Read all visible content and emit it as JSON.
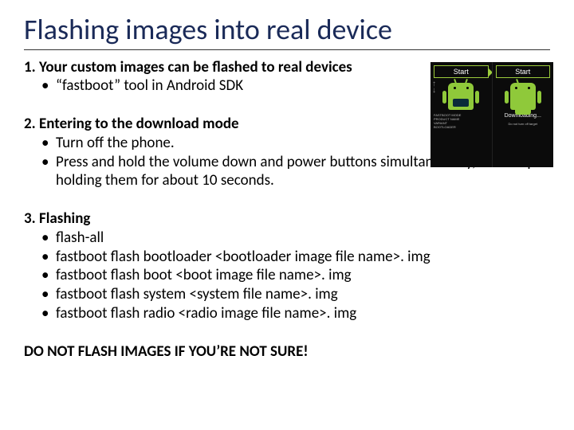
{
  "title": "Flashing images into real device",
  "section1": {
    "head": "1. Your custom images can be flashed to real devices",
    "b1": "“fastboot” tool in Android SDK"
  },
  "section2": {
    "head": "2. Entering to the download mode",
    "b1": "Turn off the phone.",
    "b2": "Press and hold the volume down and power buttons simultaneously, and keep holding them for about 10 seconds."
  },
  "section3": {
    "head": "3. Flashing",
    "b1": "flash-all",
    "b2": "fastboot flash bootloader <bootloader image file name>. img",
    "b3": "fastboot flash boot <boot image file name>. img",
    "b4": "fastboot flash system <system file name>. img",
    "b5": "fastboot flash radio <radio image file name>. img"
  },
  "warning": "DO NOT FLASH IMAGES IF YOU’RE NOT SURE!",
  "device": {
    "start": "Start",
    "downloading": "Downloading..."
  }
}
